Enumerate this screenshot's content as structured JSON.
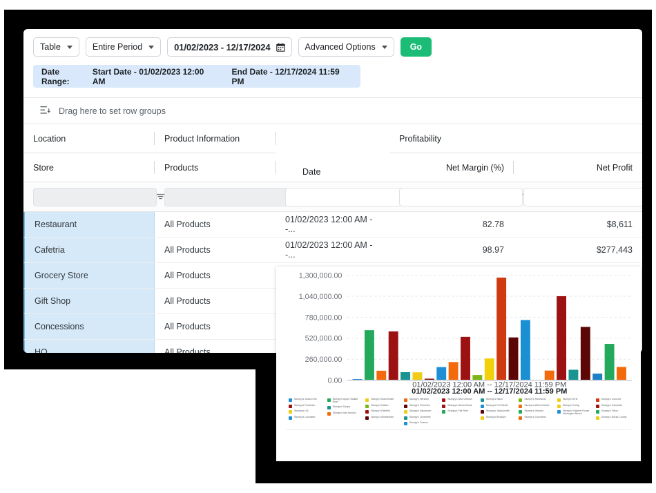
{
  "toolbar": {
    "view_select": "Table",
    "period_select": "Entire Period",
    "date_range_value": "01/02/2023 - 12/17/2024",
    "calendar_icon": "calendar-icon",
    "advanced_options": "Advanced Options",
    "go_label": "Go",
    "go_color": "#1abc76"
  },
  "range_banner": {
    "label": "Date Range:",
    "start": "Start Date - 01/02/2023 12:00 AM",
    "end": "End Date - 12/17/2024 11:59 PM",
    "background": "#d9e9fb"
  },
  "grid": {
    "rowgroup_icon": "row-group-icon",
    "rowgroup_text": "Drag here to set row groups",
    "header_tier1": [
      "Location",
      "Product Information",
      "",
      "Profitability",
      ""
    ],
    "header_date": "Date",
    "header_tier2": [
      "Store",
      "Products",
      "",
      "Net Margin (%)",
      "Net Profit"
    ],
    "filter_icon": "filter-menu-icon",
    "rows": [
      {
        "store": "Restaurant",
        "products": "All Products",
        "date": "01/02/2023 12:00 AM --...",
        "net_margin": "82.78",
        "net_profit": "$8,611"
      },
      {
        "store": "Cafetria",
        "products": "All Products",
        "date": "01/02/2023 12:00 AM --...",
        "net_margin": "98.97",
        "net_profit": "$277,443"
      },
      {
        "store": "Grocery Store",
        "products": "All Products",
        "date": "",
        "net_margin": "",
        "net_profit": ""
      },
      {
        "store": "Gift Shop",
        "products": "All Products",
        "date": "",
        "net_margin": "",
        "net_profit": ""
      },
      {
        "store": "Concessions",
        "products": "All Products",
        "date": "",
        "net_margin": "",
        "net_profit": ""
      },
      {
        "store": "HQ",
        "products": "All Products",
        "date": "",
        "net_margin": "",
        "net_profit": ""
      }
    ]
  },
  "chart_data": {
    "type": "bar",
    "title": "",
    "xlabel_line1": "01/02/2023 12:00 AM -- 12/17/2024 11:59 PM",
    "xlabel_line2": "01/02/2023 12:00 AM -- 12/17/2024 11:59 PM",
    "ylabel": "",
    "ylim": [
      0,
      1300000
    ],
    "yticks": [
      0,
      260000,
      520000,
      780000,
      1040000,
      1300000
    ],
    "ytick_labels": [
      "0.00",
      "260,000.00",
      "520,000.00",
      "780,000.00",
      "1,040,000.00",
      "1,300,000.00"
    ],
    "grid": true,
    "legend_position": "bottom",
    "categories": [
      "01/02/2023 12:00 AM -- 12/17/2024 11:59 PM"
    ],
    "bars": [
      {
        "name": "Stumpy's Judson Hill",
        "value": 14000,
        "color": "#1f7fc4"
      },
      {
        "name": "Stumpy's Upper Saddle River",
        "value": 620000,
        "color": "#22a95b"
      },
      {
        "name": "Stumpy's Manchester",
        "value": 118000,
        "color": "#f26a0c"
      },
      {
        "name": "Stumpy's Hershey",
        "value": 604000,
        "color": "#9c1212"
      },
      {
        "name": "Stumpy's New Orleans",
        "value": 100000,
        "color": "#1a9490"
      },
      {
        "name": "Stumpy's Frederick",
        "value": 98000,
        "color": "#f0cc17"
      },
      {
        "name": "Stumpy's Tampa",
        "value": 20000,
        "color": "#8b1616"
      },
      {
        "name": "Stumpy's Princeton",
        "value": 163000,
        "color": "#1f8ed4"
      },
      {
        "name": "Stumpy's HQ",
        "value": 225000,
        "color": "#f26a0c"
      },
      {
        "name": "Stumpy's San Antonio",
        "value": 537000,
        "color": "#9c1212"
      },
      {
        "name": "Stumpy's Eatontown",
        "value": 65000,
        "color": "#7cb518"
      },
      {
        "name": "Stumpy's Lancaster",
        "value": 270000,
        "color": "#f2d00a"
      },
      {
        "name": "Stumpy's Fairfield",
        "value": 1270000,
        "color": "#cf3a10"
      },
      {
        "name": "Stumpy's Greenville",
        "value": 530000,
        "color": "#5c0606"
      },
      {
        "name": "Stumpy's Middletown",
        "value": 745000,
        "color": "#1a8fd4"
      },
      {
        "name": "Stumpy's Towson",
        "value": 4000,
        "color": "#f0cc17"
      },
      {
        "name": "Stumpy's Waco",
        "value": 120000,
        "color": "#f26a0c"
      },
      {
        "name": "Stumpy's Fort Worth",
        "value": 1040000,
        "color": "#9c1212"
      },
      {
        "name": "Stumpy's Jacksonville",
        "value": 130000,
        "color": "#1a9490"
      },
      {
        "name": "Stumpy's Richmond",
        "value": 660000,
        "color": "#5c0606"
      },
      {
        "name": "Stumpy's West Chester",
        "value": 82000,
        "color": "#1f7fc4"
      },
      {
        "name": "Stumpy's Orlando",
        "value": 450000,
        "color": "#22a95b"
      },
      {
        "name": "Stumpy's Columbus",
        "value": 165000,
        "color": "#f26a0c"
      }
    ],
    "legend_columns": [
      [
        {
          "name": "Stumpy's Judson Hill",
          "color": "#1f8ed4"
        },
        {
          "name": "Stumpy's Frederick",
          "color": "#9c1212"
        },
        {
          "name": "Stumpy's HQ",
          "color": "#f0cc17"
        },
        {
          "name": "Stumpy's Lancaster",
          "color": "#1f8ed4"
        }
      ],
      [
        {
          "name": "Stumpy's Upper Saddle River",
          "color": "#22a95b"
        },
        {
          "name": "Stumpy's Tampa",
          "color": "#1a9490"
        },
        {
          "name": "Stumpy's San Antonio",
          "color": "#f26a0c"
        }
      ],
      [
        {
          "name": "Stumpy's Manchester",
          "color": "#f0cc17"
        },
        {
          "name": "Stumpy's Dalton",
          "color": "#7cb518"
        },
        {
          "name": "Stumpy's Fairfield",
          "color": "#9c1212"
        },
        {
          "name": "Stumpy's Middletown",
          "color": "#5c0606"
        }
      ],
      [
        {
          "name": "Stumpy's Hershey",
          "color": "#f26a0c"
        },
        {
          "name": "Stumpy's Princeton",
          "color": "#5c0606"
        },
        {
          "name": "Stumpy's Eatontown",
          "color": "#f0cc17"
        },
        {
          "name": "Stumpy's Greenville",
          "color": "#1a9490"
        },
        {
          "name": "Stumpy's Towson",
          "color": "#1f8ed4"
        }
      ],
      [
        {
          "name": "Stumpy's New Orleans",
          "color": "#9c1212"
        },
        {
          "name": "Stumpy's Green Brook",
          "color": "#9c1212"
        },
        {
          "name": "Stumpy's Fall River",
          "color": "#22a95b"
        }
      ],
      [
        {
          "name": "Stumpy's Waco",
          "color": "#1a9490"
        },
        {
          "name": "Stumpy's Fort Worth",
          "color": "#1f8ed4"
        },
        {
          "name": "Stumpy's Jacksonville",
          "color": "#5c0606"
        },
        {
          "name": "Stumpy's Brooklyn",
          "color": "#f0cc17"
        }
      ],
      [
        {
          "name": "Stumpy's Richmond",
          "color": "#7cb518"
        },
        {
          "name": "Stumpy's West Chester",
          "color": "#f26a0c"
        },
        {
          "name": "Stumpy's Orlando",
          "color": "#22a95b"
        },
        {
          "name": "Stumpy's Columbus",
          "color": "#f26a0c"
        }
      ],
      [
        {
          "name": "Stumpy's Erie",
          "color": "#f0cc17"
        },
        {
          "name": "Stumpy's Irving",
          "color": "#f0cc17"
        },
        {
          "name": "Stumpy's Hatchet House Huntington Beach",
          "color": "#1f8ed4"
        }
      ],
      [
        {
          "name": "Stumpy's Concord",
          "color": "#cf3a10"
        },
        {
          "name": "Stumpy's Columbia",
          "color": "#9c1212"
        },
        {
          "name": "Stumpy's Frisco",
          "color": "#22a95b"
        },
        {
          "name": "Stumpy's Bucks County",
          "color": "#f0cc17"
        }
      ]
    ]
  }
}
